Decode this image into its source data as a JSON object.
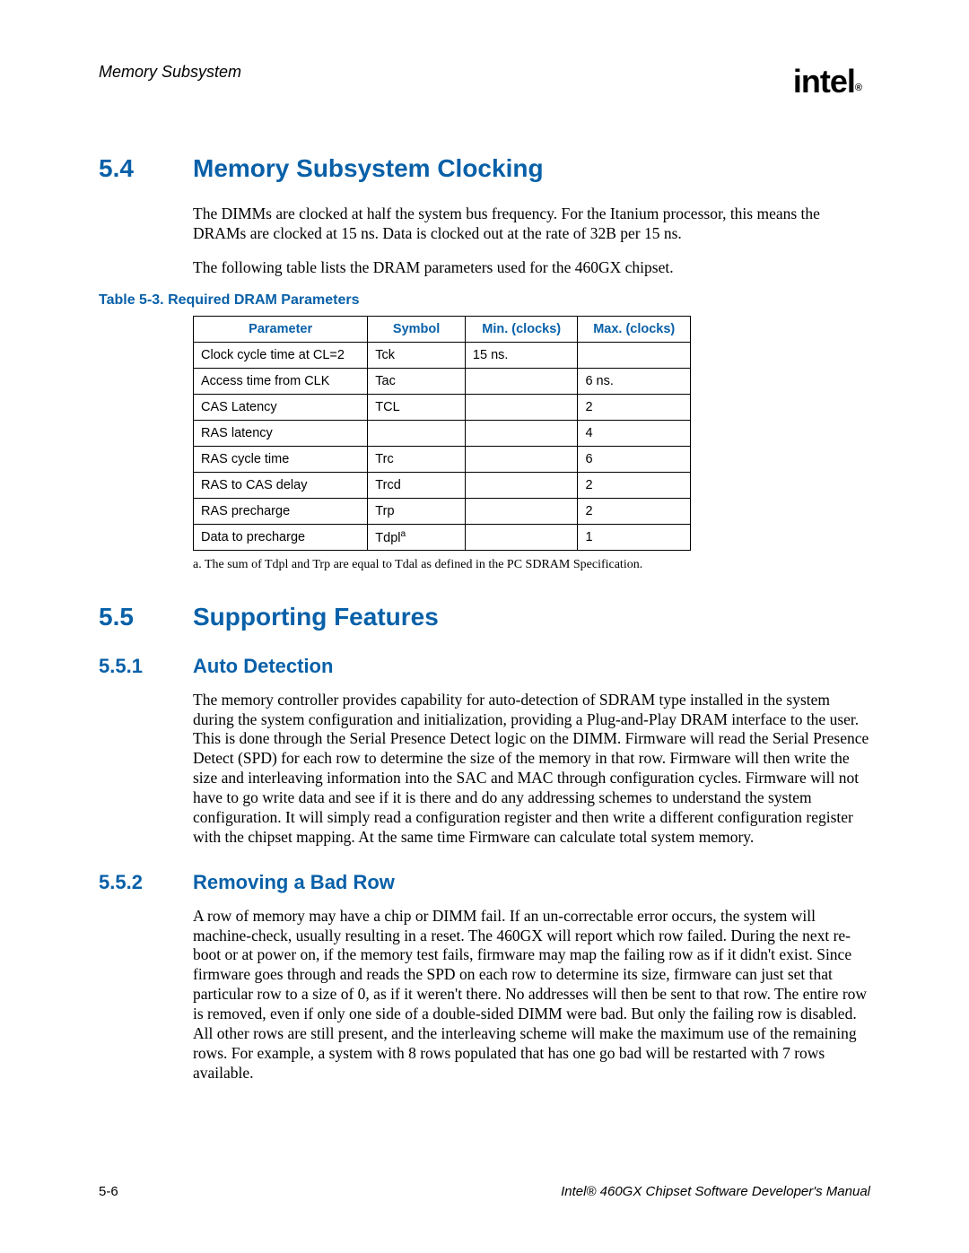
{
  "header": {
    "title": "Memory Subsystem",
    "logo": "intel",
    "logo_reg": "®"
  },
  "section54": {
    "num": "5.4",
    "title": "Memory Subsystem Clocking",
    "p1": "The DIMMs are clocked at half the system bus frequency. For  the Itanium processor, this means the DRAMs are clocked at 15 ns. Data is clocked out at the rate of 32B per 15 ns.",
    "p2": "The following table lists the DRAM parameters used for the 460GX chipset."
  },
  "table": {
    "caption": "Table 5-3. Required DRAM Parameters",
    "headers": {
      "param": "Parameter",
      "symbol": "Symbol",
      "min": "Min. (clocks)",
      "max": "Max. (clocks)"
    },
    "rows": [
      {
        "param": "Clock cycle time at CL=2",
        "symbol": "Tck",
        "min": "15 ns.",
        "max": ""
      },
      {
        "param": "Access time from CLK",
        "symbol": "Tac",
        "min": "",
        "max": "6 ns."
      },
      {
        "param": "CAS Latency",
        "symbol": "TCL",
        "min": "",
        "max": "2"
      },
      {
        "param": "RAS latency",
        "symbol": "",
        "min": "",
        "max": "4"
      },
      {
        "param": "RAS cycle time",
        "symbol": "Trc",
        "min": "",
        "max": "6"
      },
      {
        "param": "RAS to CAS delay",
        "symbol": "Trcd",
        "min": "",
        "max": "2"
      },
      {
        "param": "RAS precharge",
        "symbol": "Trp",
        "min": "",
        "max": "2"
      },
      {
        "param": "Data to precharge",
        "symbol": "Tdpl",
        "sup": "a",
        "min": "",
        "max": "1"
      }
    ],
    "footnote": "a. The sum of Tdpl and Trp are equal to Tdal as defined in the PC SDRAM Specification."
  },
  "section55": {
    "num": "5.5",
    "title": "Supporting Features"
  },
  "section551": {
    "num": "5.5.1",
    "title": "Auto Detection",
    "p1": "The memory controller provides capability for auto-detection of SDRAM type installed in the system during the system configuration and initialization, providing a Plug-and-Play DRAM interface to the user. This is done through the Serial Presence Detect logic on the DIMM. Firmware will read the Serial Presence Detect (SPD) for each row to determine the size of the memory in that row. Firmware will then write the size and interleaving information into the SAC and MAC through configuration cycles. Firmware will not have to go write data and see if it is there and do any addressing schemes to understand the system configuration. It will simply read a configuration register and then write a different configuration register with the chipset mapping. At the same time Firmware can calculate total system memory."
  },
  "section552": {
    "num": "5.5.2",
    "title": "Removing a Bad Row",
    "p1": "A row of memory may have a chip or DIMM fail. If an un-correctable error occurs, the system will machine-check, usually resulting in a reset. The 460GX will report which row failed. During the next re-boot or at power on, if the memory test fails, firmware may map the failing row as if it didn't exist. Since firmware goes through and reads the SPD on each row to determine its size, firmware can just set that particular row to a size of 0, as if it weren't there. No addresses will then be sent to that row. The entire row is removed, even if only one side of a double-sided DIMM were bad. But only the failing row is disabled. All other rows are still present, and the interleaving scheme will make the maximum use of the remaining rows. For example, a system with 8 rows populated that has one go bad will be restarted with 7 rows available."
  },
  "footer": {
    "left": "5-6",
    "right": "Intel® 460GX Chipset Software Developer's Manual"
  }
}
